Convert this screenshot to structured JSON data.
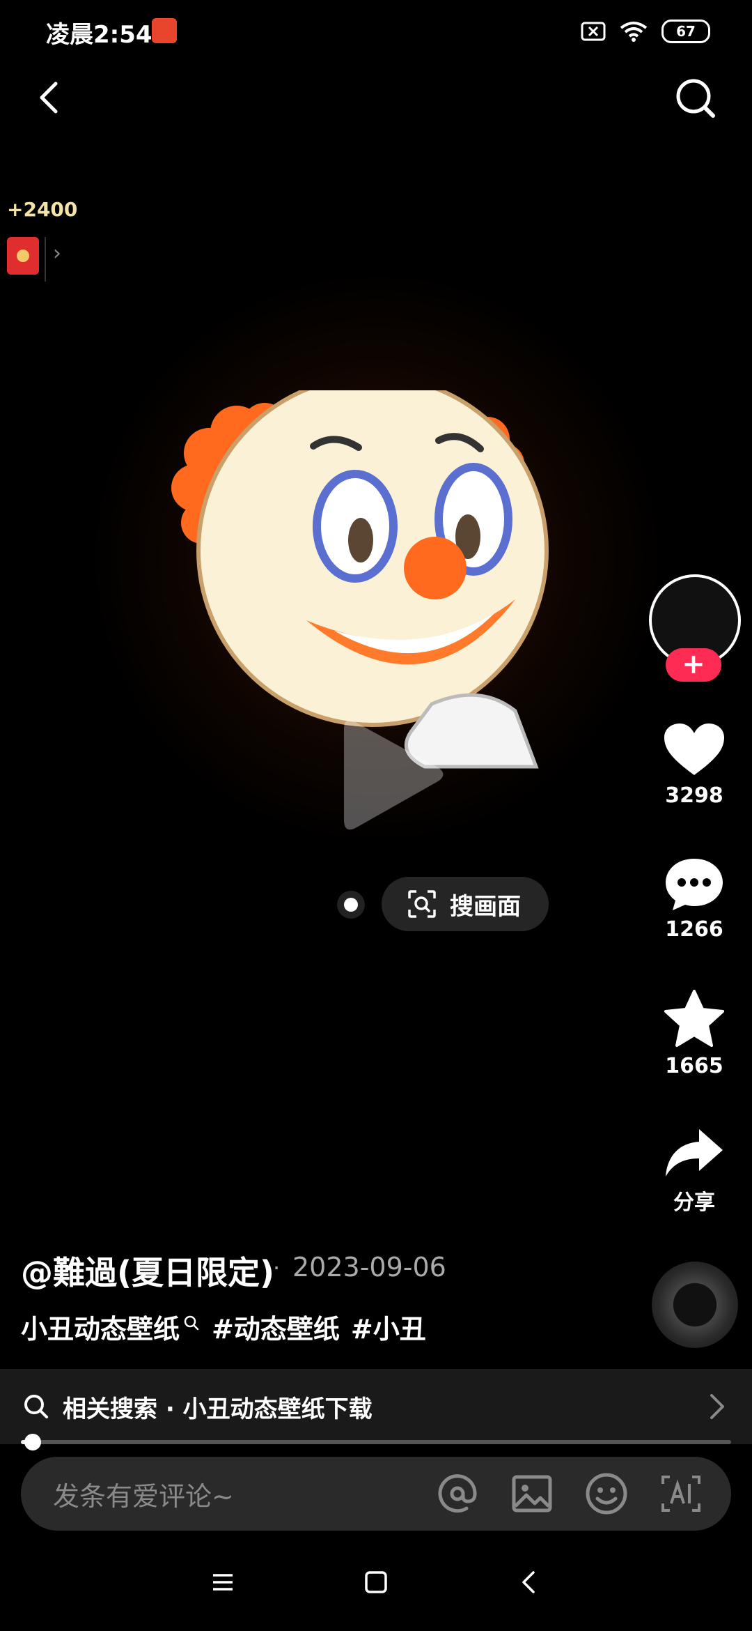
{
  "status_bar": {
    "time": "凌晨2:54",
    "battery": "67"
  },
  "reward": {
    "amount": "+2400"
  },
  "video": {
    "scan_label": "搜画面"
  },
  "rail": {
    "follow_label": "+",
    "likes": "3298",
    "comments": "1266",
    "favorites": "1665",
    "share_label": "分享"
  },
  "caption": {
    "author": "@難過(夏日限定)",
    "separator": "·",
    "date": "2023-09-06",
    "title": "小丑动态壁纸",
    "tags": [
      "#动态壁纸",
      "#小丑"
    ]
  },
  "related": {
    "text": "相关搜索 · 小丑动态壁纸下载"
  },
  "progress": {
    "fraction": 0.017
  },
  "comment": {
    "placeholder": "发条有爱评论~"
  },
  "colors": {
    "accent": "#fe2c55",
    "background": "#000000"
  }
}
